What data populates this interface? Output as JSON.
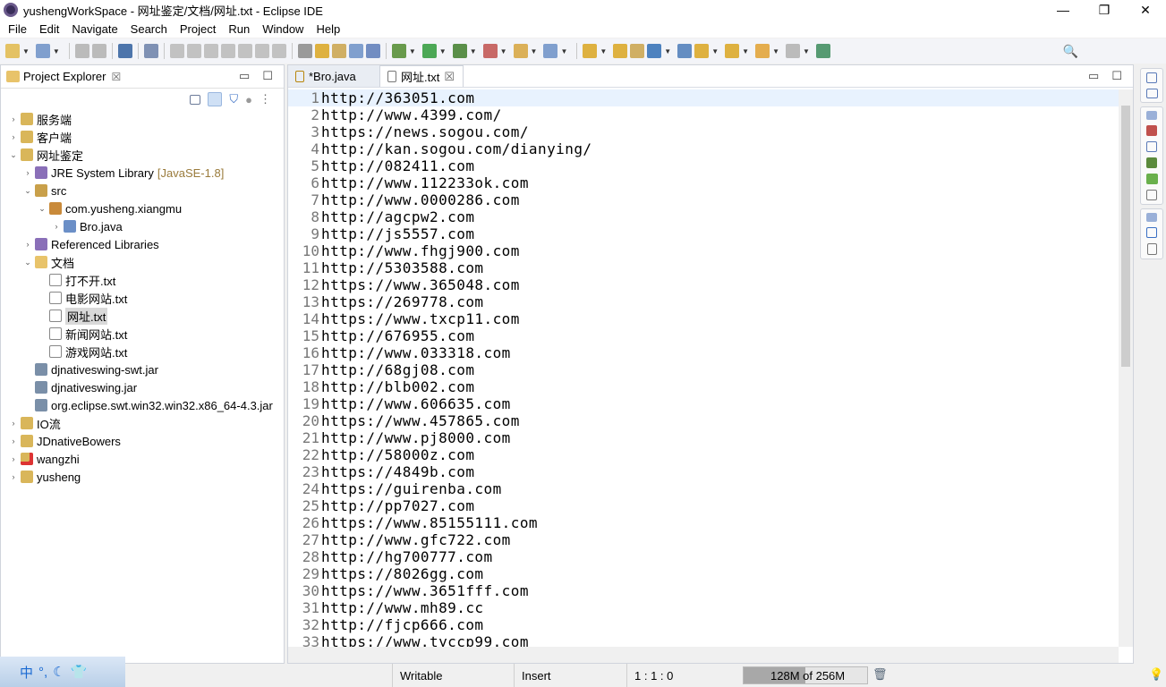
{
  "window": {
    "title": "yushengWorkSpace - 网址鉴定/文档/网址.txt - Eclipse IDE",
    "minimize": "—",
    "maximize": "❐",
    "close": "✕"
  },
  "menu": [
    "File",
    "Edit",
    "Navigate",
    "Search",
    "Project",
    "Run",
    "Window",
    "Help"
  ],
  "toolbar": {
    "icons": [
      "new-icon",
      "new-class-icon",
      "save-icon",
      "save-all-icon",
      "terminal-icon",
      "skip-breakpoints-icon",
      "resume-icon",
      "suspend-icon",
      "terminate-icon",
      "disconnect-icon",
      "step-into-icon",
      "step-over-icon",
      "step-return-icon",
      "word-wrap-icon",
      "block-select-icon",
      "open-task-icon",
      "toggle-mark-icon",
      "show-whitespace-icon",
      "debug-icon",
      "run-icon",
      "coverage-icon",
      "external-tools-icon",
      "new-java-project-icon",
      "new-package-icon",
      "open-type-icon",
      "open-folder-icon",
      "search-tool-icon",
      "web-browser-icon",
      "next-annotation-icon",
      "prev-annotation-icon",
      "last-edit-icon",
      "back-icon",
      "forward-icon",
      "pin-icon"
    ],
    "search_icon": "search-icon"
  },
  "explorer": {
    "title": "Project Explorer",
    "close": "☒",
    "tree": [
      {
        "label": "服务端",
        "level": 0,
        "twisty": "›",
        "icon": "project"
      },
      {
        "label": "客户端",
        "level": 0,
        "twisty": "›",
        "icon": "project"
      },
      {
        "label": "网址鉴定",
        "level": 0,
        "twisty": "⌄",
        "icon": "project"
      },
      {
        "label": "JRE System Library",
        "deco": "[JavaSE-1.8]",
        "level": 1,
        "twisty": "›",
        "icon": "library"
      },
      {
        "label": "src",
        "level": 1,
        "twisty": "⌄",
        "icon": "src"
      },
      {
        "label": "com.yusheng.xiangmu",
        "level": 2,
        "twisty": "⌄",
        "icon": "package"
      },
      {
        "label": "Bro.java",
        "level": 3,
        "twisty": "›",
        "icon": "java"
      },
      {
        "label": "Referenced Libraries",
        "level": 1,
        "twisty": "›",
        "icon": "library"
      },
      {
        "label": "文档",
        "level": 1,
        "twisty": "⌄",
        "icon": "folder"
      },
      {
        "label": "打不开.txt",
        "level": 2,
        "twisty": "",
        "icon": "file"
      },
      {
        "label": "电影网站.txt",
        "level": 2,
        "twisty": "",
        "icon": "file"
      },
      {
        "label": "网址.txt",
        "level": 2,
        "twisty": "",
        "icon": "file",
        "selected": true
      },
      {
        "label": "新闻网站.txt",
        "level": 2,
        "twisty": "",
        "icon": "file"
      },
      {
        "label": "游戏网站.txt",
        "level": 2,
        "twisty": "",
        "icon": "file"
      },
      {
        "label": "djnativeswing-swt.jar",
        "level": 1,
        "twisty": "",
        "icon": "jar"
      },
      {
        "label": "djnativeswing.jar",
        "level": 1,
        "twisty": "",
        "icon": "jar"
      },
      {
        "label": "org.eclipse.swt.win32.win32.x86_64-4.3.jar",
        "level": 1,
        "twisty": "",
        "icon": "jar"
      },
      {
        "label": "IO流",
        "level": 0,
        "twisty": "›",
        "icon": "project"
      },
      {
        "label": "JDnativeBowers",
        "level": 0,
        "twisty": "›",
        "icon": "project"
      },
      {
        "label": "wangzhi",
        "level": 0,
        "twisty": "›",
        "icon": "project-error"
      },
      {
        "label": "yusheng",
        "level": 0,
        "twisty": "›",
        "icon": "project"
      }
    ]
  },
  "editor": {
    "tabs": [
      {
        "label": "*Bro.java",
        "active": false
      },
      {
        "label": "网址.txt",
        "active": true,
        "close": "☒"
      }
    ],
    "lines": [
      "http://363051.com",
      "http://www.4399.com/",
      "https://news.sogou.com/",
      "http://kan.sogou.com/dianying/",
      "http://082411.com",
      "http://www.112233ok.com",
      "http://www.0000286.com",
      "http://agcpw2.com",
      "http://js5557.com",
      "http://www.fhgj900.com",
      "http://5303588.com",
      "https://www.365048.com",
      "https://269778.com",
      "https://www.txcp11.com",
      "http://676955.com",
      "http://www.033318.com",
      "http://68gj08.com",
      "http://blb002.com",
      "http://www.606635.com",
      "https://www.457865.com",
      "http://www.pj8000.com",
      "http://58000z.com",
      "https://4849b.com",
      "https://guirenba.com",
      "http://pp7027.com",
      "https://www.85155111.com",
      "http://www.gfc722.com",
      "http://hg700777.com",
      "https://8026gg.com",
      "https://www.3651fff.com",
      "http://www.mh89.cc",
      "http://fjcp666.com",
      "https://www.tyccp99.com"
    ]
  },
  "status": {
    "writable": "Writable",
    "insert": "Insert",
    "position": "1 : 1 : 0",
    "heap": "128M of 256M",
    "heap_fraction": 0.5
  },
  "ime": {
    "label": "中"
  }
}
